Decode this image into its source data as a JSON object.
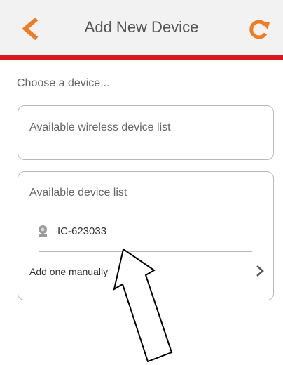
{
  "header": {
    "title": "Add New Device",
    "accent_color": "#f07c23",
    "bar_color": "#d7191f",
    "back_icon": "chevron-left-icon",
    "refresh_icon": "refresh-icon"
  },
  "prompt": "Choose a device...",
  "wireless_list": {
    "title": "Available wireless device list"
  },
  "device_list": {
    "title": "Available device list",
    "devices": [
      {
        "name": "IC-623033",
        "icon": "camera-icon"
      }
    ],
    "add_manual_label": "Add one manually"
  }
}
